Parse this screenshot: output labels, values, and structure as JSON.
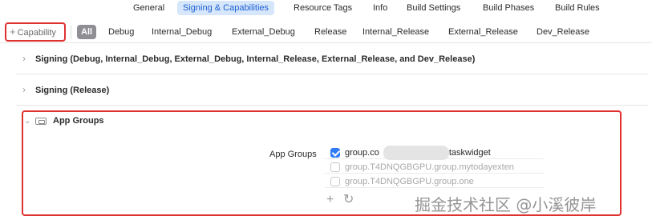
{
  "tabs": [
    {
      "label": "General",
      "active": false
    },
    {
      "label": "Signing & Capabilities",
      "active": true
    },
    {
      "label": "Resource Tags",
      "active": false
    },
    {
      "label": "Info",
      "active": false
    },
    {
      "label": "Build Settings",
      "active": false
    },
    {
      "label": "Build Phases",
      "active": false
    },
    {
      "label": "Build Rules",
      "active": false
    }
  ],
  "filter_bar": {
    "capability_button": "Capability",
    "filters": [
      "All",
      "Debug",
      "Internal_Debug",
      "External_Debug",
      "Release",
      "Internal_Release",
      "External_Release",
      "Dev_Release"
    ],
    "selected": "All"
  },
  "sections": [
    {
      "title": "Signing (Debug, Internal_Debug, External_Debug, Internal_Release, External_Release, and Dev_Release)",
      "expanded": false
    },
    {
      "title": "Signing (Release)",
      "expanded": false
    }
  ],
  "app_groups": {
    "title": "App Groups",
    "field_label": "App Groups",
    "groups": [
      {
        "left": "group.co",
        "right": ".taskwidget",
        "checked": true,
        "dimmed": false
      },
      {
        "text": "group.T4DNQGBGPU.group.mytodayexten",
        "checked": false,
        "dimmed": true
      },
      {
        "text": "group.T4DNQGBGPU.group.one",
        "checked": false,
        "dimmed": true
      }
    ],
    "add_symbol": "+",
    "refresh_symbol": "↻"
  },
  "watermark": "掘金技术社区 @小溪彼岸",
  "colors": {
    "accent": "#2f7cf6",
    "highlight_border": "#e03131",
    "active_tab_bg": "#d6e6fb"
  }
}
